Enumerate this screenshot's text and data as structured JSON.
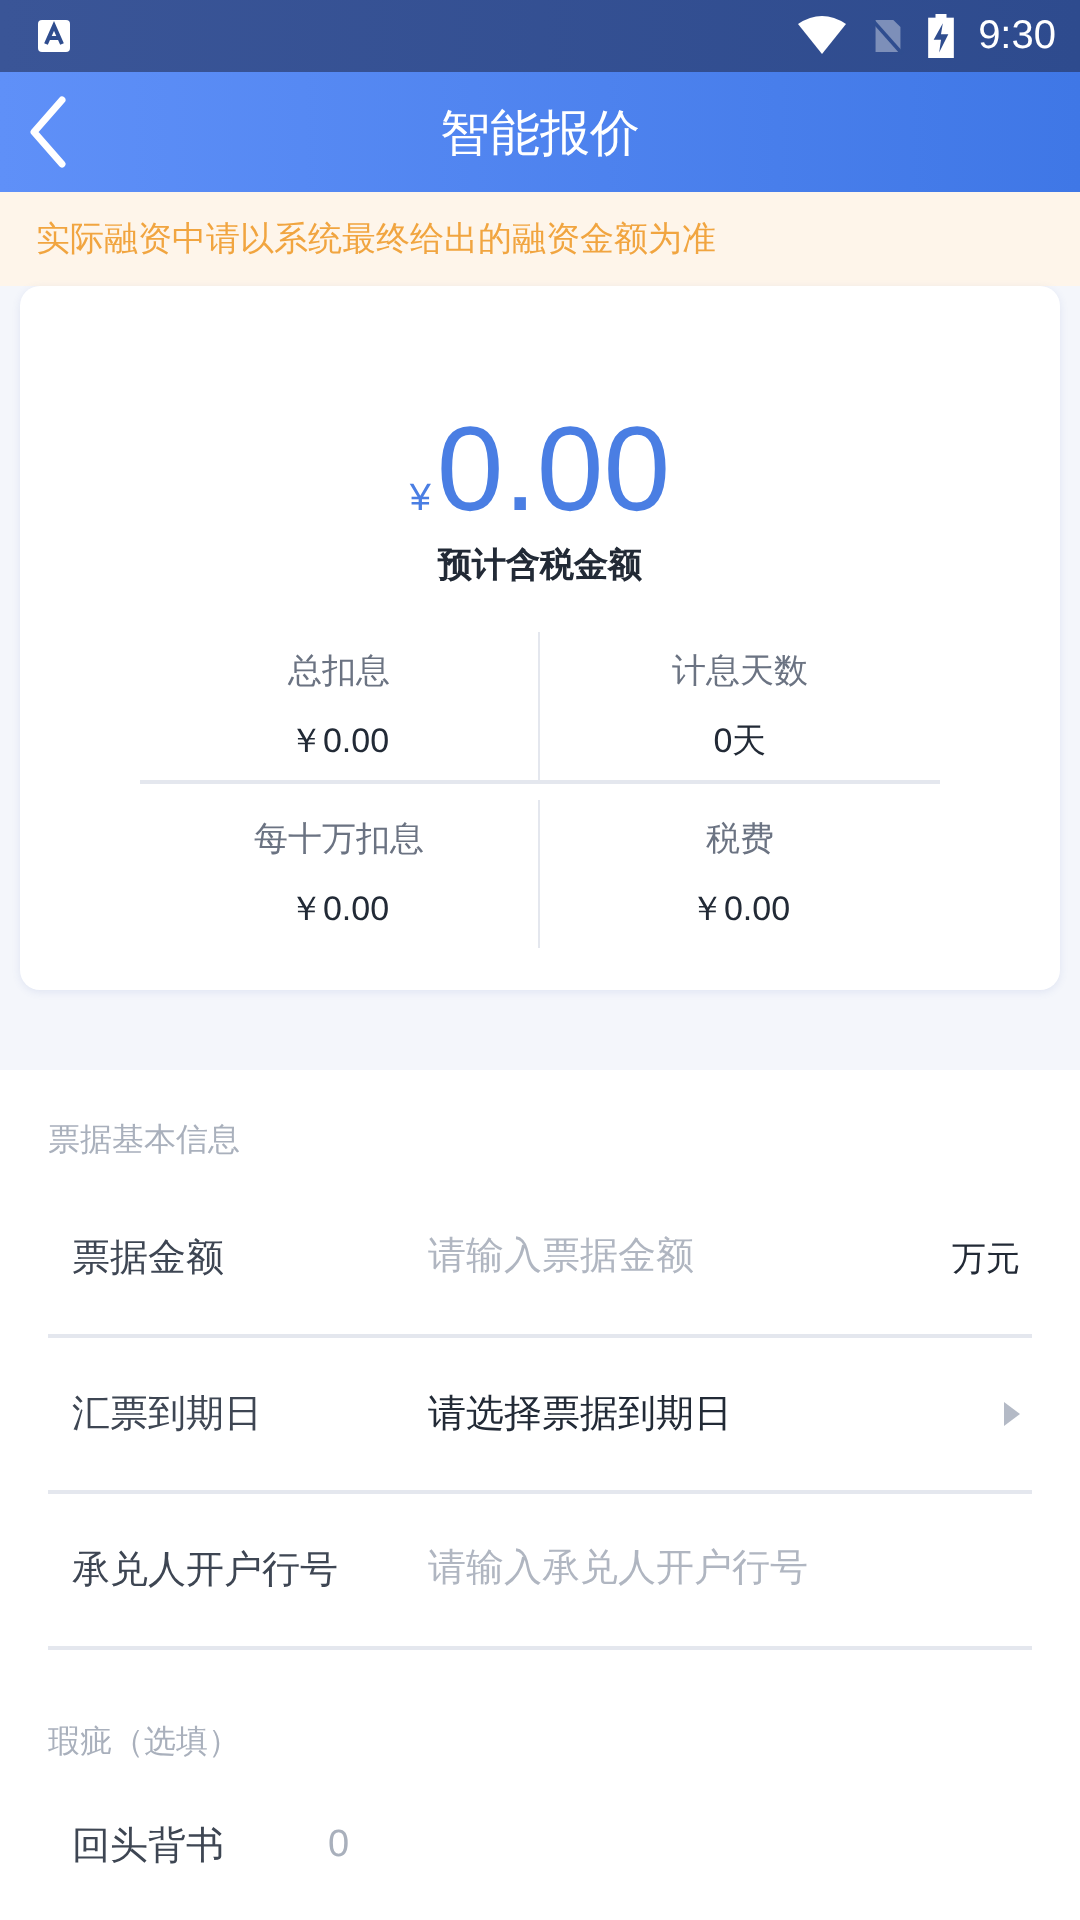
{
  "status_bar": {
    "time": "9:30"
  },
  "header": {
    "title": "智能报价"
  },
  "notice": "实际融资中请以系统最终给出的融资金额为准",
  "summary": {
    "currency": "¥",
    "amount": "0.00",
    "caption": "预计含税金额",
    "stats": [
      {
        "label": "总扣息",
        "value": "￥0.00"
      },
      {
        "label": "计息天数",
        "value": "0天"
      },
      {
        "label": "每十万扣息",
        "value": "￥0.00"
      },
      {
        "label": "税费",
        "value": "￥0.00"
      }
    ]
  },
  "sections": [
    {
      "title": "票据基本信息",
      "rows": [
        {
          "kind": "input",
          "label": "票据金额",
          "placeholder": "请输入票据金额",
          "unit": "万元"
        },
        {
          "kind": "select",
          "label": "汇票到期日",
          "value": "请选择票据到期日"
        },
        {
          "kind": "input",
          "label": "承兑人开户行号",
          "placeholder": "请输入承兑人开户行号"
        }
      ]
    },
    {
      "title": "瑕疵（选填）",
      "rows": [
        {
          "kind": "count",
          "label": "回头背书",
          "value": "0"
        }
      ]
    }
  ]
}
